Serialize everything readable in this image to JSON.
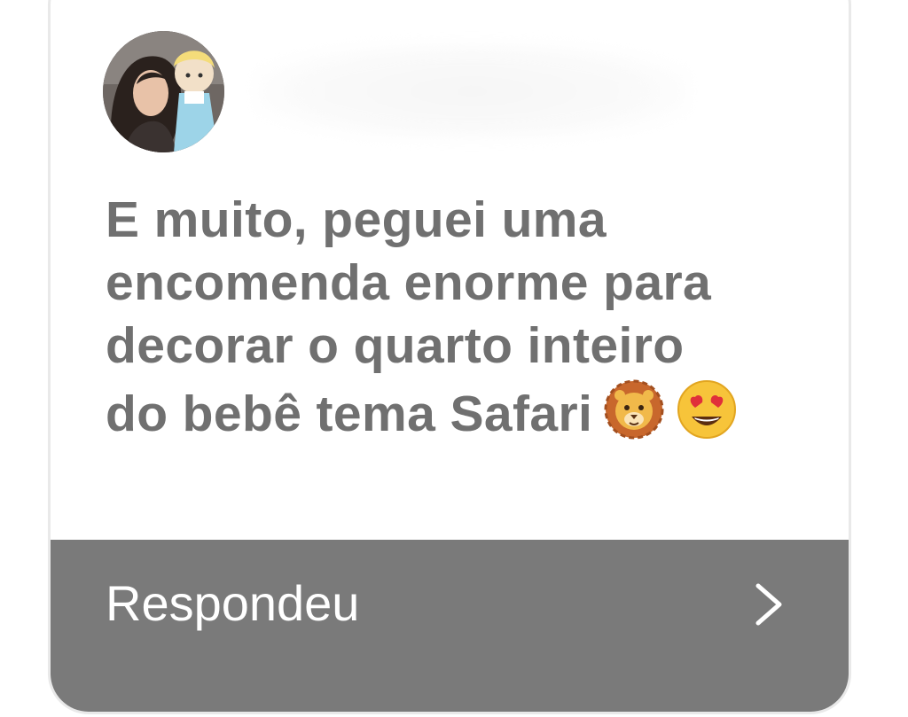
{
  "card": {
    "message_lines": [
      "E muito, peguei uma",
      "encomenda enorme para",
      "decorar o quarto inteiro",
      "do bebê tema Safari"
    ],
    "emojis": [
      "lion-face-icon",
      "heart-eyes-face-icon"
    ],
    "footer_label": "Respondeu",
    "footer_icon": "chevron-right-icon"
  },
  "colors": {
    "message_text": "#707070",
    "footer_background": "#7a7a7a",
    "footer_text": "#ffffff",
    "card_border": "#e9e9e9"
  }
}
